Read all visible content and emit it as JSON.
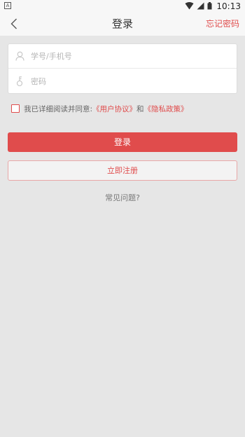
{
  "status_bar": {
    "time": "10:13",
    "icons": [
      "notification-a-icon",
      "wifi-icon",
      "signal-icon",
      "battery-icon"
    ]
  },
  "nav": {
    "title": "登录",
    "forgot_password": "忘记密码"
  },
  "form": {
    "username_placeholder": "学号/手机号",
    "username_value": "",
    "password_placeholder": "密码",
    "password_value": ""
  },
  "agreement": {
    "prefix": "我已详细阅读并同意:",
    "user_agreement": "《用户协议》",
    "and": "和",
    "privacy_policy": "《隐私政策》",
    "checked": false
  },
  "buttons": {
    "login": "登录",
    "register": "立即注册"
  },
  "faq": "常见问题?",
  "colors": {
    "accent": "#e04c4c",
    "background": "#e6e6e6",
    "navbar": "#f7f7f7"
  }
}
